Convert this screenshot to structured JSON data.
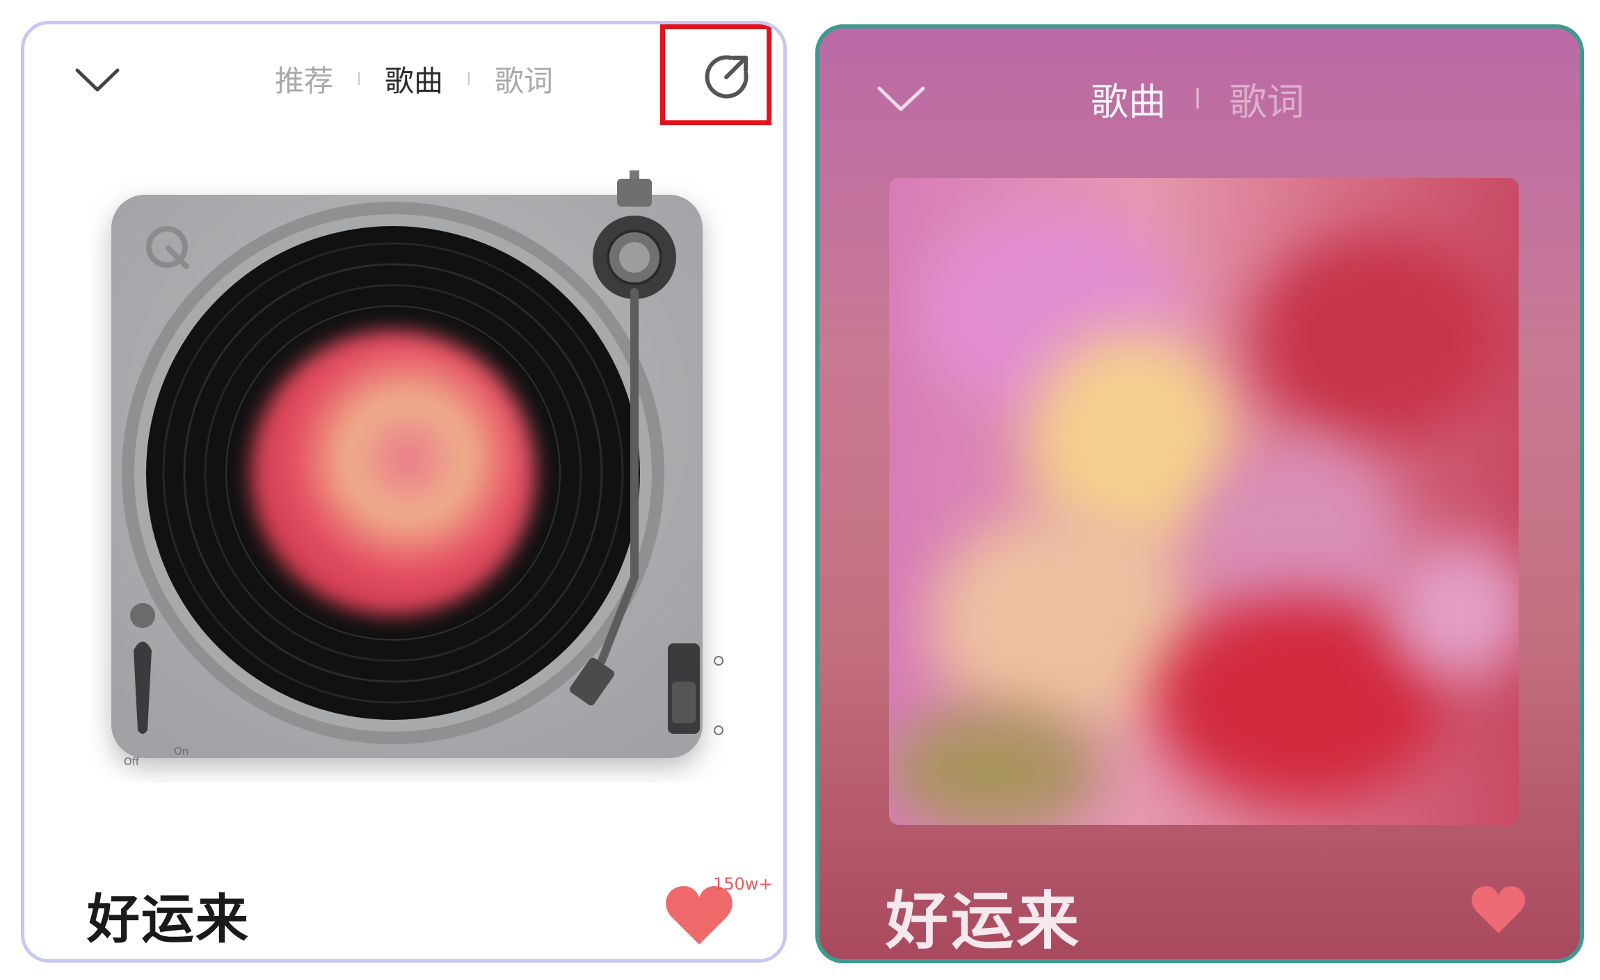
{
  "left_panel": {
    "tabs": [
      {
        "label": "推荐",
        "active": false
      },
      {
        "label": "歌曲",
        "active": true
      },
      {
        "label": "歌词",
        "active": false
      }
    ],
    "song_title": "好运来",
    "like_count": "150w+",
    "turntable_labels": {
      "off": "Off",
      "on": "On"
    },
    "icons": [
      "chevron-down-icon",
      "share-icon",
      "heart-icon",
      "app-logo-icon"
    ],
    "highlight_color": "#e3121b",
    "border_color": "#c6c7f2"
  },
  "right_panel": {
    "tabs": [
      {
        "label": "歌曲",
        "active": true
      },
      {
        "label": "歌词",
        "active": false
      }
    ],
    "song_title": "好运来",
    "icons": [
      "chevron-down-icon",
      "heart-icon"
    ],
    "border_color": "#3e9a8e",
    "heart_color": "#ee6a74"
  }
}
